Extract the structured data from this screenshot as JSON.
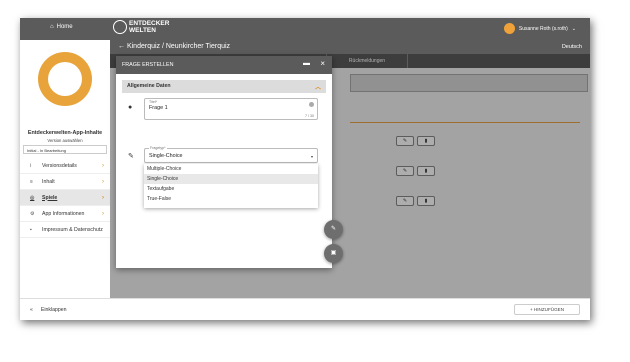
{
  "topbar": {
    "home_label": "Home",
    "logo_line1": "ENTDECKER",
    "logo_line2": "WELTEN",
    "user_name": "Susanne Roth (s.roth)"
  },
  "sidebar": {
    "title": "Entdeckerwelten-App-Inhalte",
    "subtitle": "Version auswählen",
    "version_value": "Initial - In Bearbeitung",
    "items": [
      {
        "label": "Versionsdetails",
        "icon": "info-icon"
      },
      {
        "label": "Inhalt",
        "icon": "list-icon"
      },
      {
        "label": "Spiele",
        "icon": "gamepad-icon"
      },
      {
        "label": "App Informationen",
        "icon": "cogs-icon"
      },
      {
        "label": "Impressum & Datenschutz",
        "icon": "lock-icon"
      }
    ],
    "collapse_label": "Einklappen"
  },
  "main": {
    "title": "Kinderquiz / Neunkircher Tierquiz",
    "language": "Deutsch",
    "tab_label": "Rückmeldungen",
    "add_button_label": "+ HINZUFÜGEN"
  },
  "modal": {
    "title": "FRAGE ERSTELLEN",
    "section_title": "Allgemeine Daten",
    "title_field": {
      "label": "Titel*",
      "value": "Frage 1",
      "counter": "7 / 30"
    },
    "type_field": {
      "label": "Fragetyp*",
      "value": "Single-Choice"
    },
    "type_options": [
      "Multiple-Choice",
      "Single-Choice",
      "Textaufgabe",
      "True-False"
    ]
  },
  "colors": {
    "accent": "#e8a43b",
    "header": "#5b5b5b"
  }
}
